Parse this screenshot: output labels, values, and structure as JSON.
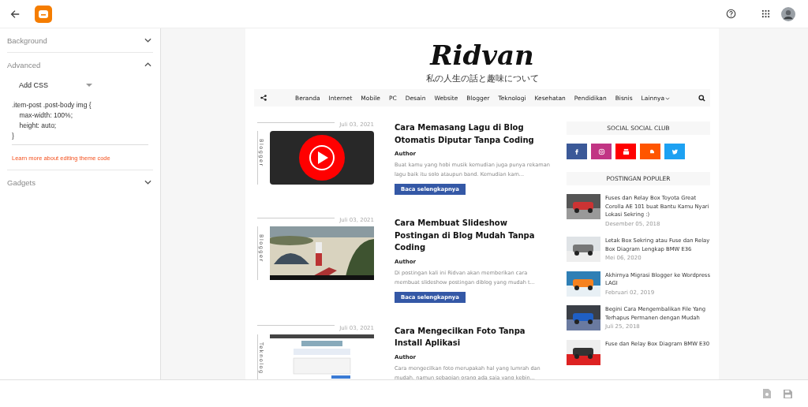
{
  "sections": [
    {
      "label": "Background",
      "expanded": false
    },
    {
      "label": "Advanced",
      "expanded": true,
      "dropdown": "Add CSS",
      "code": ".item-post .post-body img {\n    max-width: 100%;\n    height: auto;\n}",
      "link": "Learn more about editing theme code"
    },
    {
      "label": "Gadgets",
      "expanded": false
    }
  ],
  "blog": {
    "title": "Ridvan",
    "subtitle": "私の人生の話と趣味について",
    "nav": [
      {
        "label": "Beranda",
        "dropdown": false
      },
      {
        "label": "Internet",
        "dropdown": false
      },
      {
        "label": "Mobile",
        "dropdown": false
      },
      {
        "label": "PC",
        "dropdown": false
      },
      {
        "label": "Desain",
        "dropdown": false
      },
      {
        "label": "Website",
        "dropdown": false
      },
      {
        "label": "Blogger",
        "dropdown": false
      },
      {
        "label": "Teknologi",
        "dropdown": false
      },
      {
        "label": "Kesehatan",
        "dropdown": false
      },
      {
        "label": "Pendidikan",
        "dropdown": false
      },
      {
        "label": "Bisnis",
        "dropdown": false
      },
      {
        "label": "Lainnya",
        "dropdown": true
      }
    ],
    "posts": [
      {
        "date": "Juli 03, 2021",
        "category": "Blogger",
        "title": "Cara Memasang Lagu di Blog Otomatis Diputar Tanpa Coding",
        "author": "Author",
        "excerpt": "Buat kamu yang hobi musik kemudian juga punya rekaman lagu baik itu solo ataupun band. Kemudian kam...",
        "button": "Baca selengkapnya"
      },
      {
        "date": "Juli 03, 2021",
        "category": "Blogger",
        "title": "Cara Membuat Slideshow Postingan di Blog Mudah Tanpa Coding",
        "author": "Author",
        "excerpt": "Di postingan kali ini Ridvan akan memberikan cara membuat slideshow postingan diblog yang mudah t...",
        "button": "Baca selengkapnya"
      },
      {
        "date": "Juli 03, 2021",
        "category": "Teknolog",
        "title": "Cara Mengecilkan Foto Tanpa Install Aplikasi",
        "author": "Author",
        "excerpt": "Cara mengecilkan foto merupakah hal yang lumrah dan mudah, namun sebagian orang ada saja yang kebin..."
      }
    ],
    "social_heading": "SOCIAL SOCIAL CLUB",
    "social": [
      {
        "kind": "facebook",
        "color": "#3b5998"
      },
      {
        "kind": "instagram",
        "color": "#c13584"
      },
      {
        "kind": "youtube",
        "color": "#ff0000"
      },
      {
        "kind": "soundcloud",
        "color": "#ff5500"
      },
      {
        "kind": "twitter",
        "color": "#1da1f2"
      }
    ],
    "popular_heading": "POSTINGAN POPULER",
    "popular": [
      {
        "title": "Fuses dan Relay Box Toyota Great Corolla AE 101 buat Bantu Kamu Nyari Lokasi Sekring :)",
        "date": "Desember 05, 2018"
      },
      {
        "title": "Letak Box Sekring atau Fuse dan Relay Box Diagram Lengkap BMW E36",
        "date": "Mei 06, 2020"
      },
      {
        "title": "Akhirnya Migrasi Blogger ke Wordpress LAGI",
        "date": "Februari 02, 2019"
      },
      {
        "title": "Begini Cara Mengembalikan File Yang Terhapus Permanen dengan Mudah",
        "date": "Juli 25, 2018"
      },
      {
        "title": "Fuse dan Relay Box Diagram BMW E30"
      }
    ]
  }
}
